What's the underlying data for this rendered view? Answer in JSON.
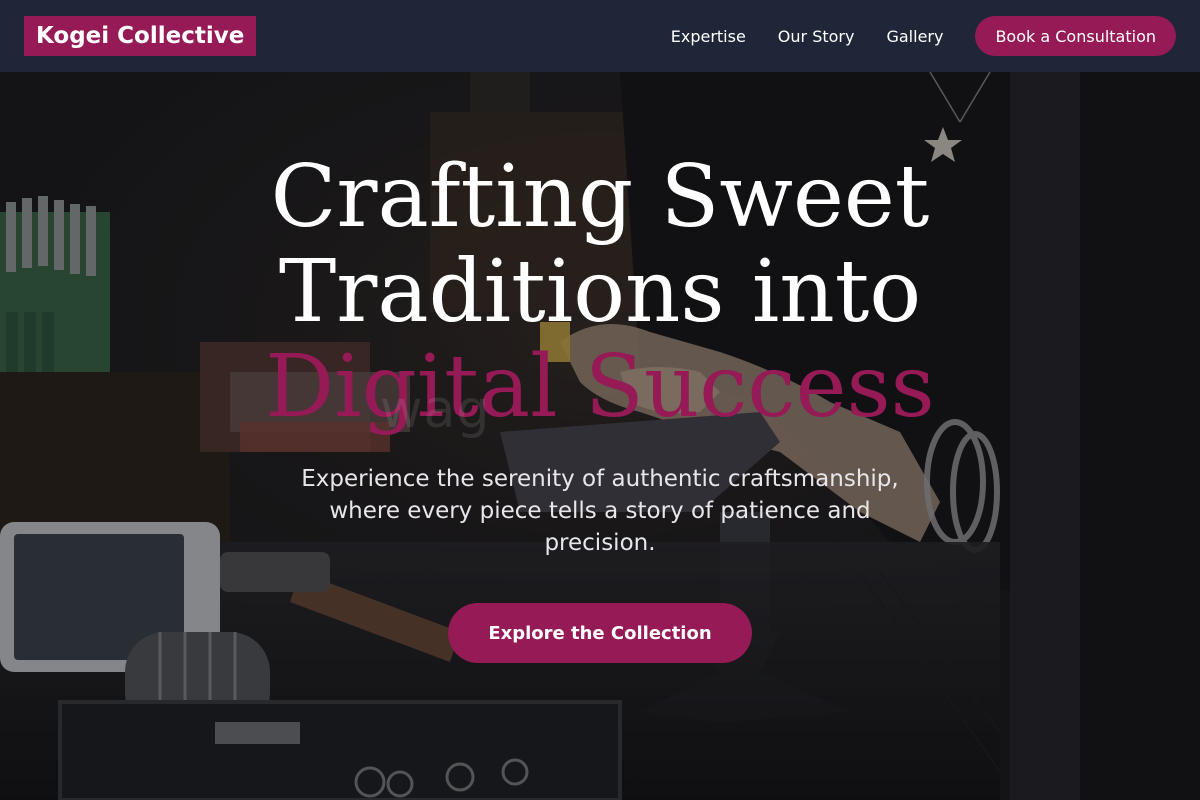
{
  "brand": {
    "name": "Kogei Collective",
    "accent_color": "#951a55",
    "nav_bg": "#1e2638"
  },
  "nav": {
    "links": [
      "Expertise",
      "Our Story",
      "Gallery"
    ],
    "cta_label": "Book a Consultation"
  },
  "hero": {
    "headline_part1": "Crafting Sweet Traditions into ",
    "headline_accent": "Digital Success",
    "watermark": "wag",
    "subtitle": "Experience the serenity of authentic craftsmanship, where every piece tells a story of patience and precision.",
    "cta_label": "Explore the Collection",
    "background_image": "artisan-workbench-photo"
  }
}
